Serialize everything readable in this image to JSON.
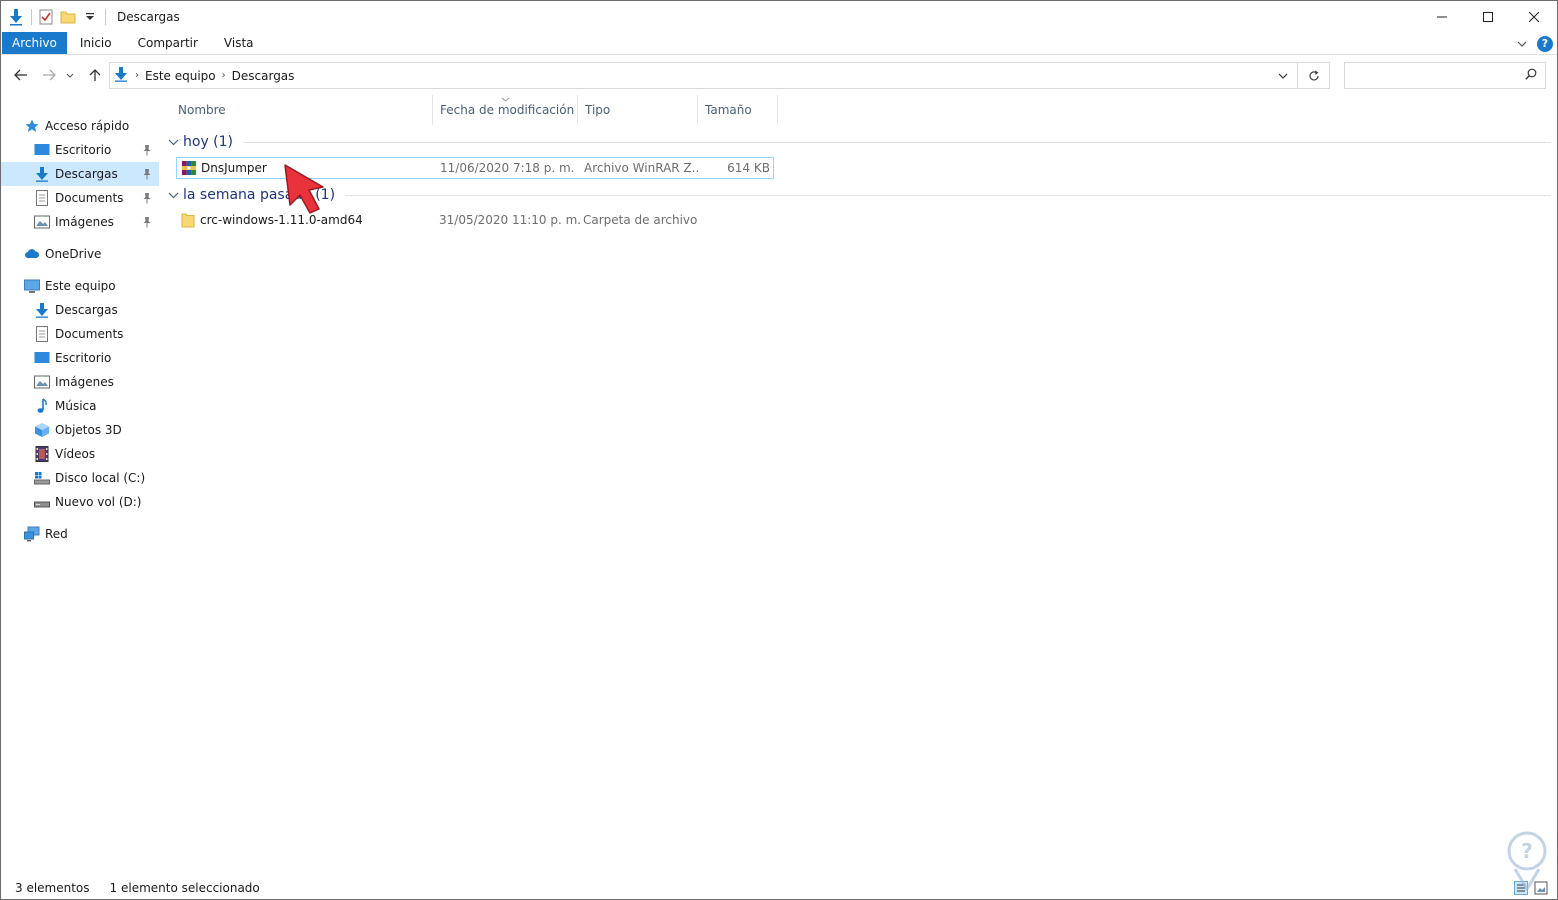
{
  "window": {
    "title": "Descargas"
  },
  "ribbon": {
    "tabs": [
      {
        "label": "Archivo",
        "active": true
      },
      {
        "label": "Inicio"
      },
      {
        "label": "Compartir"
      },
      {
        "label": "Vista"
      }
    ],
    "help_label": "?"
  },
  "address": {
    "crumbs": [
      "Este equipo",
      "Descargas"
    ],
    "search_placeholder": ""
  },
  "nav": {
    "quick_access": "Acceso rápido",
    "quick_items": [
      {
        "label": "Escritorio",
        "icon": "desktop-icon",
        "pinned": true
      },
      {
        "label": "Descargas",
        "icon": "download-icon",
        "pinned": true,
        "selected": true
      },
      {
        "label": "Documents",
        "icon": "document-icon",
        "pinned": true
      },
      {
        "label": "Imágenes",
        "icon": "pictures-icon",
        "pinned": true
      }
    ],
    "onedrive": "OneDrive",
    "this_pc": "Este equipo",
    "pc_items": [
      {
        "label": "Descargas",
        "icon": "download-icon"
      },
      {
        "label": "Documents",
        "icon": "document-icon"
      },
      {
        "label": "Escritorio",
        "icon": "desktop-icon"
      },
      {
        "label": "Imágenes",
        "icon": "pictures-icon"
      },
      {
        "label": "Música",
        "icon": "music-icon"
      },
      {
        "label": "Objetos 3D",
        "icon": "3d-objects-icon"
      },
      {
        "label": "Vídeos",
        "icon": "videos-icon"
      },
      {
        "label": "Disco local (C:)",
        "icon": "local-disk-icon"
      },
      {
        "label": "Nuevo vol (D:)",
        "icon": "drive-icon"
      }
    ],
    "network": "Red"
  },
  "columns": {
    "name": "Nombre",
    "date": "Fecha de modificación",
    "type": "Tipo",
    "size": "Tamaño"
  },
  "groups": [
    {
      "title": "hoy (1)",
      "files": [
        {
          "name": "DnsJumper",
          "date": "11/06/2020 7:18 p. m.",
          "type": "Archivo WinRAR Z...",
          "size": "614 KB",
          "icon": "winrar-archive-icon",
          "selected": true
        }
      ]
    },
    {
      "title": "la semana pasada (1)",
      "files": [
        {
          "name": "crc-windows-1.11.0-amd64",
          "date": "31/05/2020 11:10 p. m.",
          "type": "Carpeta de archivos",
          "size": "",
          "icon": "folder-icon"
        }
      ]
    }
  ],
  "status": {
    "count": "3 elementos",
    "selection": "1 elemento seleccionado"
  },
  "colors": {
    "accent": "#1979ca",
    "selection": "#cce8ff",
    "group_title": "#1e3287",
    "cursor": "#e8323c"
  }
}
